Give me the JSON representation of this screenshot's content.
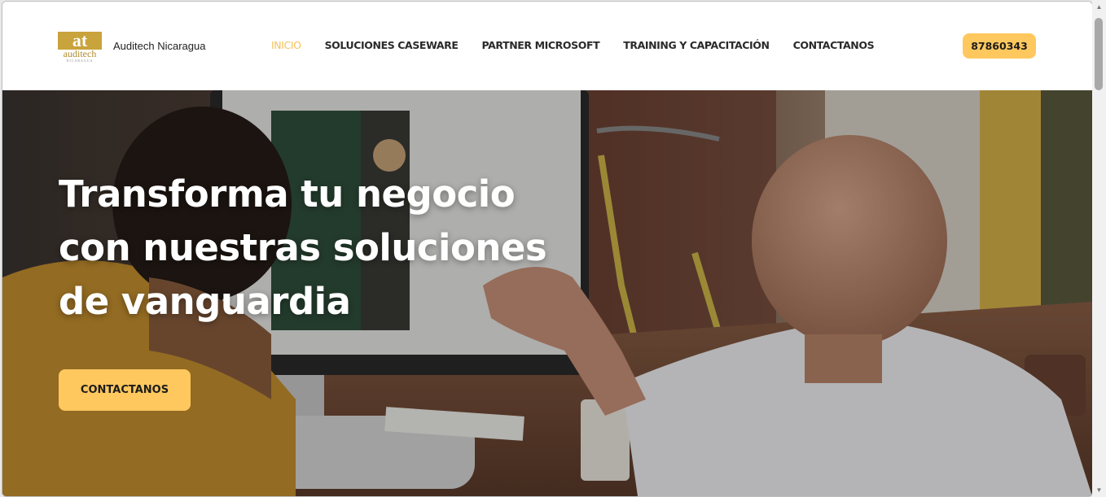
{
  "header": {
    "logo_text": "at auditech NICARAGUA",
    "brand_name": "Auditech Nicaragua",
    "nav": [
      {
        "label": "INICIO",
        "active": true
      },
      {
        "label": "SOLUCIONES CASEWARE",
        "active": false
      },
      {
        "label": "PARTNER MICROSOFT",
        "active": false
      },
      {
        "label": "TRAINING Y CAPACITACIÓN",
        "active": false
      },
      {
        "label": "CONTACTANOS",
        "active": false
      }
    ],
    "phone": "87860343"
  },
  "hero": {
    "title": "Transforma tu negocio con nuestras soluciones de vanguardia",
    "cta": "CONTACTANOS"
  },
  "colors": {
    "accent": "#ffc85e",
    "nav_active": "#f5c15a",
    "logo_gold": "#c9a33b"
  }
}
